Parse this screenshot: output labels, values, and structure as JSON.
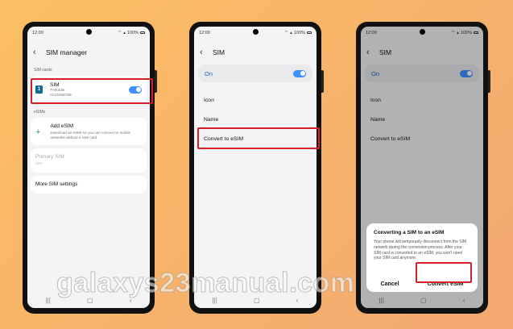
{
  "status": {
    "time": "12:00",
    "battery": "100%"
  },
  "screen1": {
    "title": "SIM manager",
    "sim_cards_label": "SIM cards",
    "sim": {
      "badge": "1",
      "name": "SIM",
      "carrier": "T-Mobile",
      "number": "0123456789"
    },
    "esims_label": "eSIMs",
    "add_esim": {
      "title": "Add eSIM",
      "desc": "Download an eSIM so you can connect to mobile networks without a SIM card."
    },
    "primary_sim": {
      "title": "Primary SIM",
      "value": "SIM"
    },
    "more_settings": "More SIM settings"
  },
  "screen2": {
    "title": "SIM",
    "on_label": "On",
    "options": [
      "Icon",
      "Name",
      "Convert to eSIM"
    ]
  },
  "screen3": {
    "title": "SIM",
    "on_label": "On",
    "options": [
      "Icon",
      "Name",
      "Convert to eSIM"
    ],
    "dialog": {
      "title": "Converting a SIM to an eSIM",
      "body": "Your phone will temporarily disconnect from the SIM network during the conversion process. After your SIM card is converted to an eSIM, you won't need your SIM card anymore.",
      "cancel": "Cancel",
      "confirm": "Convert eSIM"
    }
  },
  "watermark": "galaxys23manual.com",
  "colors": {
    "accent": "#3e91ff",
    "highlight": "#d42026",
    "on_text": "#1d63c7"
  },
  "icons": [
    "back-arrow-icon",
    "sim-card-icon",
    "plus-icon",
    "wifi-icon",
    "signal-icon",
    "battery-icon",
    "recents-icon",
    "home-icon",
    "back-nav-icon"
  ]
}
